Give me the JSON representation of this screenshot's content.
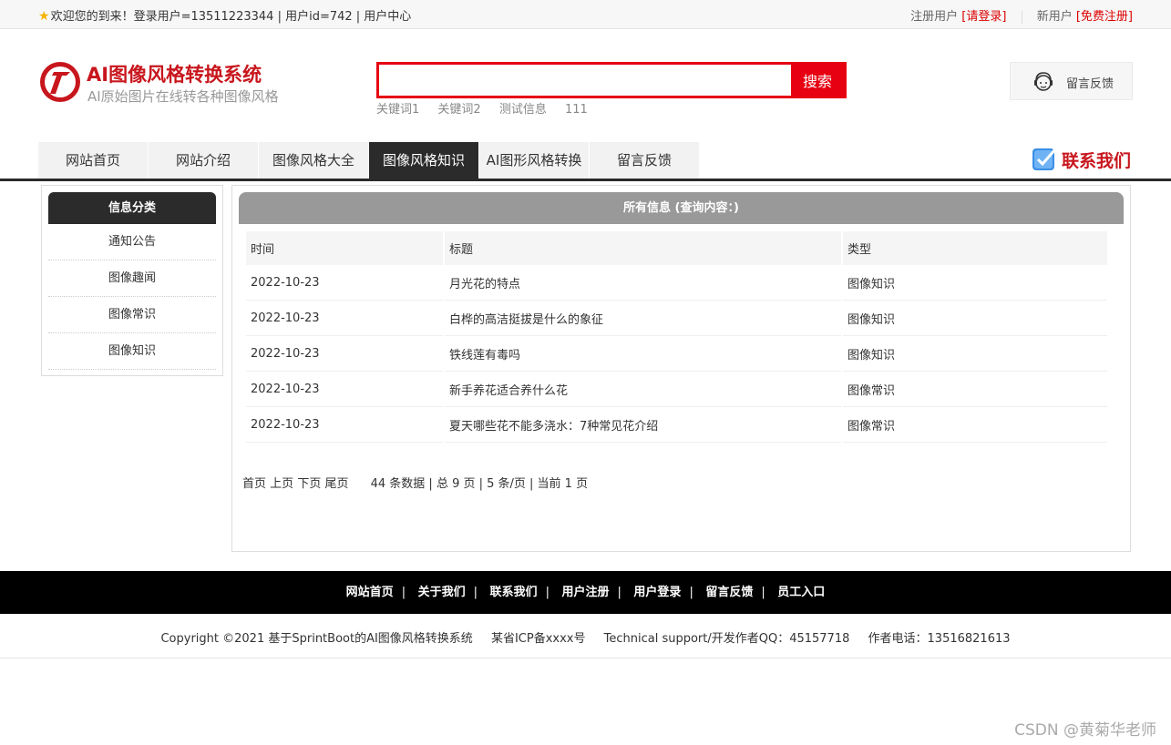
{
  "topbar": {
    "welcome": "欢迎您的到来！登录用户=13511223344 | 用户id=742 | 用户中心",
    "registered_user": "注册用户",
    "login_link": "[请登录]",
    "new_user": "新用户",
    "signup_link": "[免费注册]"
  },
  "header": {
    "title": "AI图像风格转换系统",
    "subtitle": "AI原始图片在线转各种图像风格",
    "search": {
      "value": "",
      "button": "搜索"
    },
    "hotwords": [
      "关键词1",
      "关键词2",
      "测试信息",
      "111"
    ],
    "feedback": "留言反馈",
    "contact": "联系我们"
  },
  "nav": {
    "items": [
      {
        "label": "网站首页",
        "active": false
      },
      {
        "label": "网站介绍",
        "active": false
      },
      {
        "label": "图像风格大全",
        "active": false
      },
      {
        "label": "图像风格知识",
        "active": true
      },
      {
        "label": "AI图形风格转换",
        "active": false
      },
      {
        "label": "留言反馈",
        "active": false
      }
    ]
  },
  "sidebar": {
    "title": "信息分类",
    "items": [
      "通知公告",
      "图像趣闻",
      "图像常识",
      "图像知识"
    ]
  },
  "main": {
    "title": "所有信息 (查询内容：)",
    "columns": [
      "时间",
      "标题",
      "类型"
    ],
    "rows": [
      {
        "date": "2022-10-23",
        "title": "月光花的特点",
        "type": "图像知识"
      },
      {
        "date": "2022-10-23",
        "title": "白桦的高洁挺拔是什么的象征",
        "type": "图像知识"
      },
      {
        "date": "2022-10-23",
        "title": "铁线莲有毒吗",
        "type": "图像知识"
      },
      {
        "date": "2022-10-23",
        "title": "新手养花适合养什么花",
        "type": "图像常识"
      },
      {
        "date": "2022-10-23",
        "title": "夏天哪些花不能多浇水：7种常见花介绍",
        "type": "图像常识"
      }
    ],
    "pager": {
      "first": "首页",
      "prev": "上页",
      "next": "下页",
      "last": "尾页",
      "info": "44 条数据 | 总 9 页 | 5 条/页 | 当前 1 页"
    }
  },
  "footer": {
    "links": [
      "网站首页",
      "关于我们",
      "联系我们",
      "用户注册",
      "用户登录",
      "留言反馈",
      "员工入口"
    ],
    "copyright": "Copyright ©2021 基于SprintBoot的AI图像风格转换系统",
    "icp": "某省ICP备xxxx号",
    "support": "Technical support/开发作者QQ：45157718",
    "phone": "作者电话：13516821613"
  },
  "watermark": "CSDN @黄菊华老师",
  "colors": {
    "brand_red": "#c8161d",
    "search_red": "#e60012",
    "dark": "#2b2b2b",
    "panel_gray": "#999999"
  }
}
